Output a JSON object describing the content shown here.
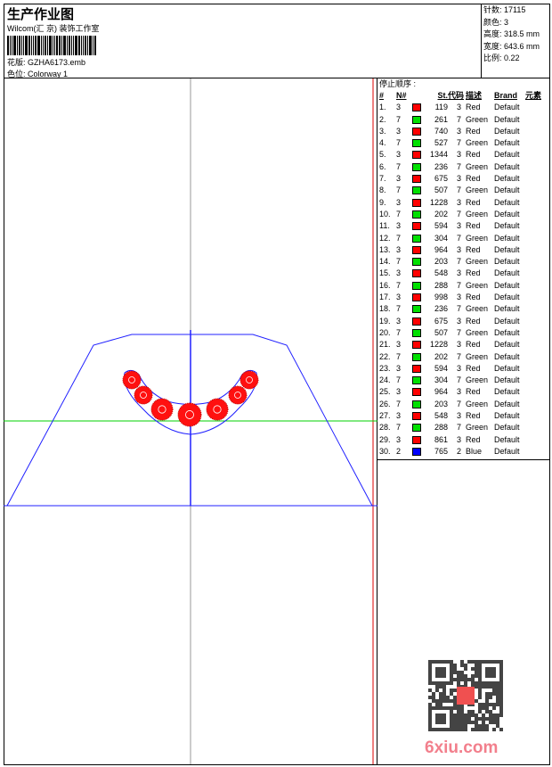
{
  "header": {
    "title": "生产作业图",
    "company": "Wilcom(汇 京) 装饰工作室",
    "design_label": "花版:",
    "design": "GZHA6173.emb",
    "colorway_label": "色位:",
    "colorway": "Colorway 1"
  },
  "info": [
    {
      "label": "针数:",
      "value": "17115"
    },
    {
      "label": "颜色:",
      "value": "3"
    },
    {
      "label": "高度:",
      "value": "318.5 mm"
    },
    {
      "label": "宽度:",
      "value": "643.6 mm"
    },
    {
      "label": "比例:",
      "value": "0.22"
    }
  ],
  "stop_sequence": {
    "title": "停止顺序 :",
    "columns": [
      "#",
      "N#",
      "",
      "St.",
      "代码",
      "描述",
      "Brand",
      "元素"
    ],
    "rows": [
      [
        "1.",
        "3",
        "#ff0000",
        "119",
        "3",
        "Red",
        "Default"
      ],
      [
        "2.",
        "7",
        "#00e000",
        "261",
        "7",
        "Green",
        "Default"
      ],
      [
        "3.",
        "3",
        "#ff0000",
        "740",
        "3",
        "Red",
        "Default"
      ],
      [
        "4.",
        "7",
        "#00e000",
        "527",
        "7",
        "Green",
        "Default"
      ],
      [
        "5.",
        "3",
        "#ff0000",
        "1344",
        "3",
        "Red",
        "Default"
      ],
      [
        "6.",
        "7",
        "#00e000",
        "236",
        "7",
        "Green",
        "Default"
      ],
      [
        "7.",
        "3",
        "#ff0000",
        "675",
        "3",
        "Red",
        "Default"
      ],
      [
        "8.",
        "7",
        "#00e000",
        "507",
        "7",
        "Green",
        "Default"
      ],
      [
        "9.",
        "3",
        "#ff0000",
        "1228",
        "3",
        "Red",
        "Default"
      ],
      [
        "10.",
        "7",
        "#00e000",
        "202",
        "7",
        "Green",
        "Default"
      ],
      [
        "11.",
        "3",
        "#ff0000",
        "594",
        "3",
        "Red",
        "Default"
      ],
      [
        "12.",
        "7",
        "#00e000",
        "304",
        "7",
        "Green",
        "Default"
      ],
      [
        "13.",
        "3",
        "#ff0000",
        "964",
        "3",
        "Red",
        "Default"
      ],
      [
        "14.",
        "7",
        "#00e000",
        "203",
        "7",
        "Green",
        "Default"
      ],
      [
        "15.",
        "3",
        "#ff0000",
        "548",
        "3",
        "Red",
        "Default"
      ],
      [
        "16.",
        "7",
        "#00e000",
        "288",
        "7",
        "Green",
        "Default"
      ],
      [
        "17.",
        "3",
        "#ff0000",
        "998",
        "3",
        "Red",
        "Default"
      ],
      [
        "18.",
        "7",
        "#00e000",
        "236",
        "7",
        "Green",
        "Default"
      ],
      [
        "19.",
        "3",
        "#ff0000",
        "675",
        "3",
        "Red",
        "Default"
      ],
      [
        "20.",
        "7",
        "#00e000",
        "507",
        "7",
        "Green",
        "Default"
      ],
      [
        "21.",
        "3",
        "#ff0000",
        "1228",
        "3",
        "Red",
        "Default"
      ],
      [
        "22.",
        "7",
        "#00e000",
        "202",
        "7",
        "Green",
        "Default"
      ],
      [
        "23.",
        "3",
        "#ff0000",
        "594",
        "3",
        "Red",
        "Default"
      ],
      [
        "24.",
        "7",
        "#00e000",
        "304",
        "7",
        "Green",
        "Default"
      ],
      [
        "25.",
        "3",
        "#ff0000",
        "964",
        "3",
        "Red",
        "Default"
      ],
      [
        "26.",
        "7",
        "#00e000",
        "203",
        "7",
        "Green",
        "Default"
      ],
      [
        "27.",
        "3",
        "#ff0000",
        "548",
        "3",
        "Red",
        "Default"
      ],
      [
        "28.",
        "7",
        "#00e000",
        "288",
        "7",
        "Green",
        "Default"
      ],
      [
        "29.",
        "3",
        "#ff0000",
        "861",
        "3",
        "Red",
        "Default"
      ],
      [
        "30.",
        "2",
        "#0000ff",
        "765",
        "2",
        "Blue",
        "Default"
      ]
    ]
  },
  "watermark": "6xiu.com"
}
